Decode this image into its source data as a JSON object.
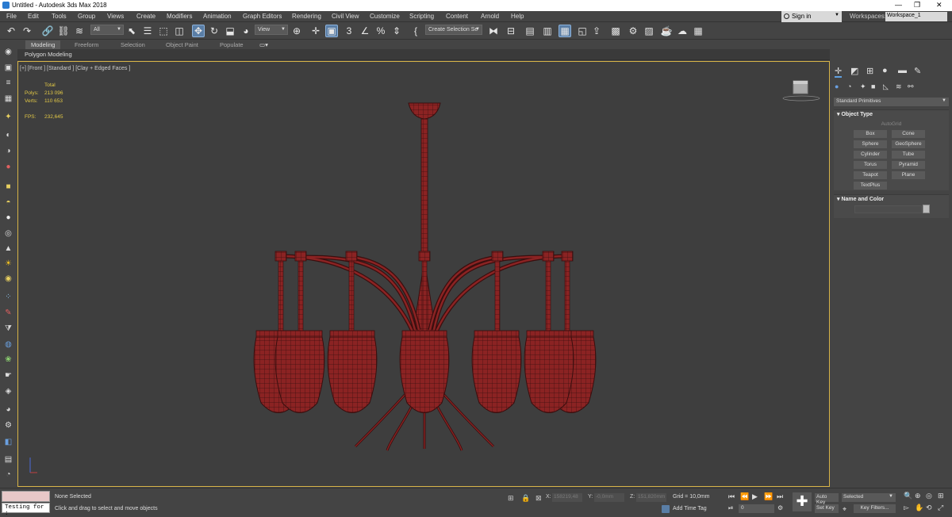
{
  "window": {
    "title": "Untitled - Autodesk 3ds Max 2018",
    "controls": [
      "—",
      "❐",
      "✕"
    ]
  },
  "menu": [
    "File",
    "Edit",
    "Tools",
    "Group",
    "Views",
    "Create",
    "Modifiers",
    "Animation",
    "Graph Editors",
    "Rendering",
    "Civil View",
    "Customize",
    "Scripting",
    "Content",
    "Arnold",
    "Help"
  ],
  "account": {
    "sign_in": "Sign in",
    "workspaces_label": "Workspaces:",
    "workspace": "Workspace_1"
  },
  "toolbar": {
    "filter": "All",
    "coord_system": "View",
    "selection_set": "Create Selection Se"
  },
  "ribbon": {
    "tabs": [
      "Modeling",
      "Freeform",
      "Selection",
      "Object Paint",
      "Populate"
    ],
    "active": "Modeling",
    "subtitle": "Polygon Modeling"
  },
  "viewport": {
    "label": "[+] [Front ] [Standard ] [Clay + Edged Faces ]",
    "stats": {
      "header": "Total",
      "polys_label": "Polys:",
      "polys": "213 096",
      "verts_label": "Verts:",
      "verts": "110 653",
      "fps_label": "FPS:",
      "fps": "232,645"
    },
    "object_color": "#8b2323"
  },
  "command_panel": {
    "category": "Standard Primitives",
    "object_type_title": "Object Type",
    "autogrid": "AutoGrid",
    "buttons": [
      "Box",
      "Cone",
      "Sphere",
      "GeoSphere",
      "Cylinder",
      "Tube",
      "Torus",
      "Pyramid",
      "Teapot",
      "Plane",
      "TextPlus"
    ],
    "name_color_title": "Name and Color"
  },
  "status": {
    "maxscript": "Testing for :",
    "selection": "None Selected",
    "prompt": "Click and drag to select and move objects",
    "x_label": "X:",
    "x": "158219,48",
    "y_label": "Y:",
    "y": "-0,0mm",
    "z_label": "Z:",
    "z": "151,820mm",
    "grid": "Grid = 10,0mm",
    "add_time_tag": "Add Time Tag",
    "frame": "0",
    "auto_key": "Auto Key",
    "set_key": "Set Key",
    "key_mode": "Selected",
    "key_filters": "Key Filters..."
  }
}
